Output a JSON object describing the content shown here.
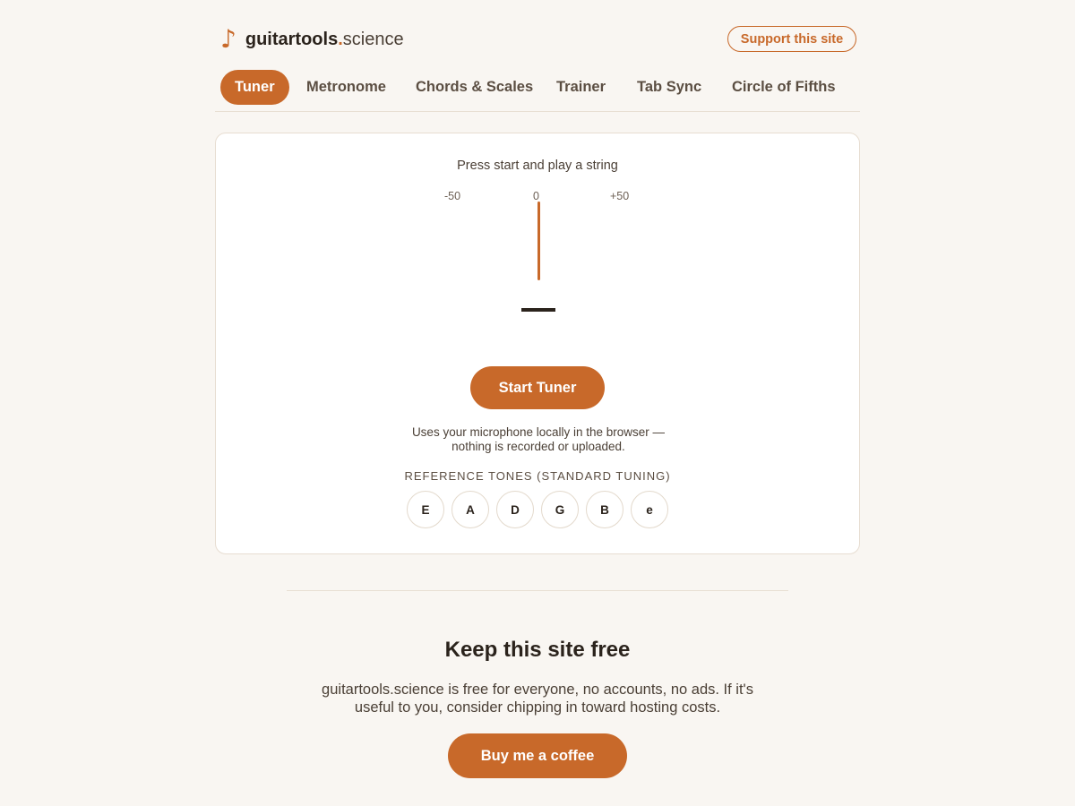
{
  "header": {
    "logo_icon": "♪",
    "logo_bold": "guitartools",
    "logo_dot": ".",
    "logo_rest": "science",
    "support_label": "Support this site"
  },
  "tabs": [
    {
      "label": "Tuner",
      "active": true
    },
    {
      "label": "Metronome",
      "active": false
    },
    {
      "label": "Chords & Scales",
      "active": false
    },
    {
      "label": "Trainer",
      "active": false
    },
    {
      "label": "Tab Sync",
      "active": false
    },
    {
      "label": "Circle of Fifths",
      "active": false
    }
  ],
  "tuner": {
    "prompt": "Press start and play a string",
    "scale": {
      "min": "-50",
      "center": "0",
      "max": "+50"
    },
    "needle_cents": 0,
    "note": "",
    "start_label": "Start Tuner",
    "mic_note_line1": "Uses your microphone locally in the browser —",
    "mic_note_line2": "nothing is recorded or uploaded.",
    "ref_title": "REFERENCE TONES (STANDARD TUNING)",
    "tones": [
      "E",
      "A",
      "D",
      "G",
      "B",
      "e"
    ]
  },
  "footer": {
    "title": "Keep this site free",
    "text_line1": "guitartools.science is free for everyone, no accounts, no ads. If it's",
    "text_line2": "useful to you, consider chipping in toward hosting costs.",
    "coffee_label": "Buy me a coffee"
  },
  "colors": {
    "accent": "#c8692a",
    "background": "#f9f6f2",
    "card": "#ffffff",
    "text": "#2b231c"
  }
}
